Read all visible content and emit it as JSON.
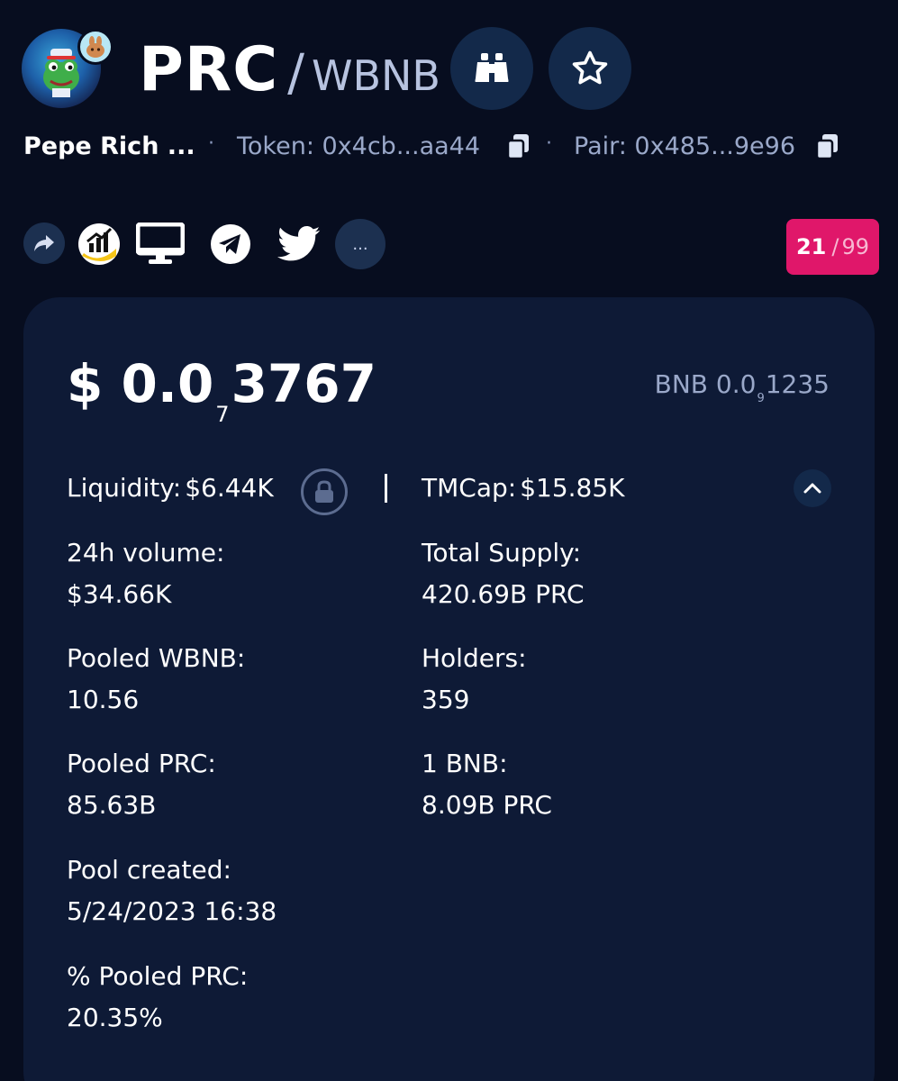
{
  "pair": {
    "base": "PRC",
    "slash": "/",
    "quote": "WBNB"
  },
  "icons": {
    "avatar": "pepe-frog-avatar",
    "chain": "pancakeswap-bunny-icon",
    "watch": "binoculars-icon",
    "favorite": "star-icon",
    "share": "share-arrow-icon",
    "chart": "coinmarketcap-chart-icon",
    "website": "monitor-icon",
    "telegram": "telegram-icon",
    "twitter": "twitter-bird-icon",
    "more": "more-icon",
    "copy": "copy-icon",
    "lock": "lock-icon",
    "collapse": "chevron-up-icon"
  },
  "token_info": {
    "name": "Pepe Rich ...",
    "dot": "·",
    "token_label": "Token: 0x4cb...aa44",
    "pair_label": "Pair: 0x485...9e96"
  },
  "social": {
    "more_label": "..."
  },
  "score": {
    "value": "21",
    "sep": "/",
    "max": "99"
  },
  "price": {
    "usd_prefix": "$ 0.0",
    "usd_zeros": "7",
    "usd_digits": "3767",
    "bnb_prefix": "BNB 0.0",
    "bnb_zeros": "9",
    "bnb_digits": "1235"
  },
  "metrics": {
    "liquidity_label": "Liquidity:",
    "liquidity_value": "$6.44K",
    "tmcap_label": "TMCap:",
    "tmcap_value": "$15.85K"
  },
  "stats": {
    "volume_label": "24h volume:",
    "volume_value": "$34.66K",
    "supply_label": "Total Supply:",
    "supply_value": "420.69B PRC",
    "pooled_wbnb_label": "Pooled WBNB:",
    "pooled_wbnb_value": "10.56",
    "holders_label": "Holders:",
    "holders_value": "359",
    "pooled_prc_label": "Pooled PRC:",
    "pooled_prc_value": "85.63B",
    "bnb_rate_label": "1 BNB:",
    "bnb_rate_value": "8.09B PRC",
    "created_label": "Pool created:",
    "created_value": "5/24/2023 16:38",
    "pct_pooled_label": "% Pooled PRC:",
    "pct_pooled_value": "20.35%"
  },
  "colors": {
    "background": "#070d1f",
    "card": "#0e1a36",
    "button": "#13294a",
    "accent_pink": "#e0176a",
    "muted_text": "#9aa8c9"
  }
}
